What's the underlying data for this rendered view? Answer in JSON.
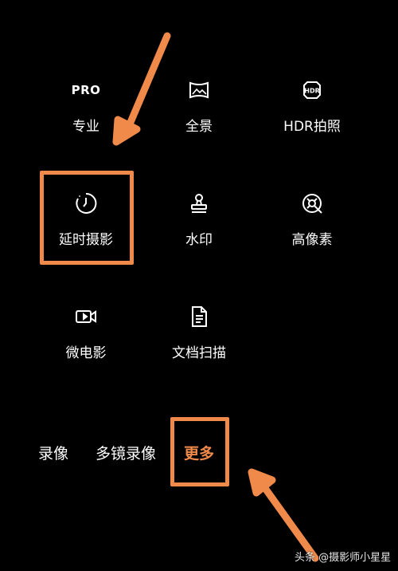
{
  "grid": {
    "items": [
      {
        "label": "专业",
        "icon": "pro-icon",
        "icon_text": "PRO"
      },
      {
        "label": "全景",
        "icon": "panorama-icon"
      },
      {
        "label": "HDR拍照",
        "icon": "hdr-icon",
        "icon_text": "HDR"
      },
      {
        "label": "延时摄影",
        "icon": "timelapse-icon"
      },
      {
        "label": "水印",
        "icon": "watermark-stamp-icon"
      },
      {
        "label": "高像素",
        "icon": "high-resolution-icon"
      },
      {
        "label": "微电影",
        "icon": "micro-movie-icon"
      },
      {
        "label": "文档扫描",
        "icon": "document-scan-icon"
      }
    ]
  },
  "mode_bar": {
    "items": [
      {
        "label": "录像"
      },
      {
        "label": "多镜录像"
      },
      {
        "label": "更多",
        "active": true
      }
    ]
  },
  "watermark": {
    "text": "头条 @摄影师小星星"
  },
  "colors": {
    "accent": "#f08a4b",
    "background": "#000000",
    "text": "#ffffff"
  }
}
